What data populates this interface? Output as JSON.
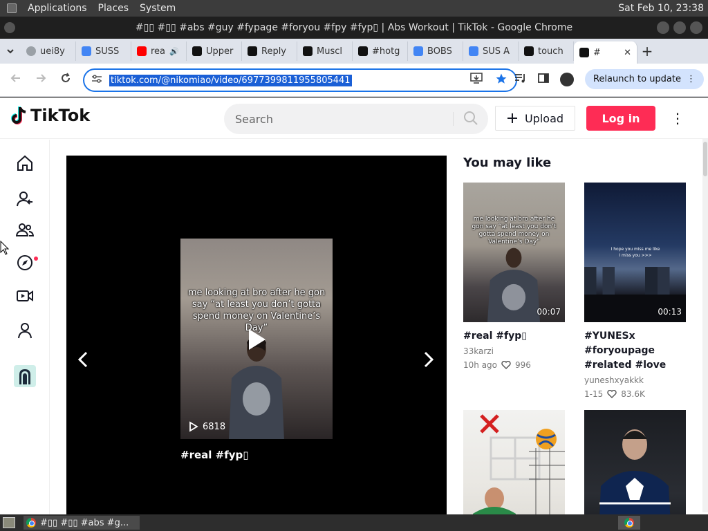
{
  "system": {
    "menu": [
      "Applications",
      "Places",
      "System"
    ],
    "clock": "Sat Feb 10, 23:38"
  },
  "window": {
    "title": "#▯▯ #▯▯ #abs #guy #fypage #foryou #fpy #fyp▯ | Abs Workout | TikTok - Google Chrome"
  },
  "tabs": [
    {
      "label": "uei8y",
      "fav": "#9aa0a6",
      "icon": "globe-icon"
    },
    {
      "label": "SUSS",
      "fav": "#4285f4",
      "icon": "google-icon"
    },
    {
      "label": "rea",
      "fav": "#ff0000",
      "icon": "youtube-icon",
      "audio": true
    },
    {
      "label": "Upper",
      "fav": "#111111",
      "icon": "tiktok-icon"
    },
    {
      "label": "Reply",
      "fav": "#111111",
      "icon": "tiktok-icon"
    },
    {
      "label": "Muscl",
      "fav": "#111111",
      "icon": "tiktok-icon"
    },
    {
      "label": "#hotg",
      "fav": "#111111",
      "icon": "tiktok-icon"
    },
    {
      "label": "BOBS",
      "fav": "#4285f4",
      "icon": "google-icon"
    },
    {
      "label": "SUS A",
      "fav": "#4285f4",
      "icon": "google-icon"
    },
    {
      "label": "touch",
      "fav": "#111111",
      "icon": "tiktok-icon"
    },
    {
      "label": "#",
      "fav": "#111111",
      "icon": "tiktok-icon",
      "active": true
    }
  ],
  "omnibox": {
    "url": "tiktok.com/@nikomiao/video/6977399811955805441",
    "relaunch": "Relaunch to update"
  },
  "tiktok": {
    "logo": "TikTok",
    "search_placeholder": "Search",
    "upload": "Upload",
    "login": "Log in"
  },
  "player": {
    "caption": "me looking at bro after he gon say “at least you don’t gotta spend money on Valentine’s Day”",
    "views": "6818",
    "title": "#real #fyp▯"
  },
  "rail": {
    "heading": "You may like",
    "items": [
      {
        "title": "#real #fyp▯",
        "author": "33karzi",
        "time": "10h ago",
        "likes": "996",
        "duration": "00:07",
        "caption": "me looking at bro after he gon say “at least you don’t gotta spend money on Valentine’s Day”"
      },
      {
        "title": "#YUNESx #foryoupage #related #love",
        "author": "yuneshxyakkk",
        "time": "1-15",
        "likes": "83.6K",
        "duration": "00:13",
        "caption": "I hope you miss me like I miss you >>>"
      },
      {
        "title": "",
        "author": "",
        "time": "",
        "likes": "",
        "duration": ""
      },
      {
        "title": "",
        "author": "",
        "time": "",
        "likes": "",
        "duration": ""
      }
    ]
  },
  "taskbar": {
    "item": "#▯▯ #▯▯ #abs #g..."
  },
  "colors": {
    "accent": "#fe2c55",
    "chrome_blue": "#1a73e8"
  }
}
